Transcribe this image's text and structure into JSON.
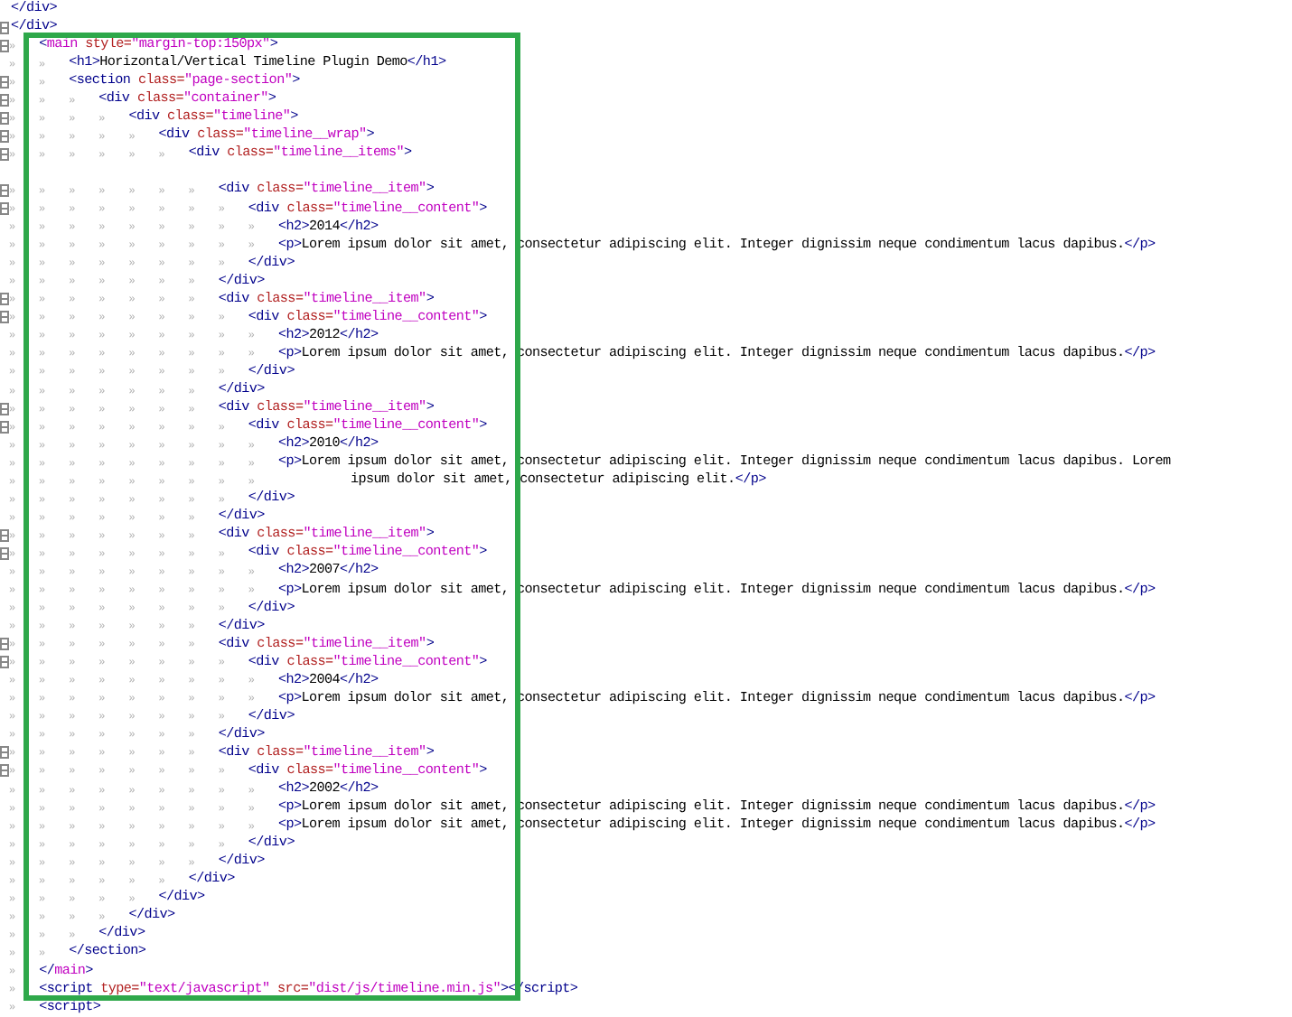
{
  "lines": [
    {
      "fold": false,
      "tokens": [
        {
          "kind": "tag",
          "text": "</div>"
        }
      ]
    },
    {
      "fold": true,
      "tokens": [
        {
          "kind": "tag",
          "text": "</div>"
        }
      ]
    },
    {
      "fold": true,
      "indent": "»",
      "tokens": [
        {
          "kind": "tag",
          "text": "<"
        },
        {
          "kind": "keyword",
          "text": "main"
        },
        {
          "kind": "attr",
          "text": " style="
        },
        {
          "kind": "value",
          "text": "\"margin-top:150px\""
        },
        {
          "kind": "tag",
          "text": ">"
        }
      ]
    },
    {
      "fold": false,
      "indent": "»»",
      "tokens": [
        {
          "kind": "tag",
          "text": "<h1>"
        },
        {
          "kind": "text",
          "text": "Horizontal/Vertical Timeline Plugin Demo"
        },
        {
          "kind": "tag",
          "text": "</h1>"
        }
      ]
    },
    {
      "fold": true,
      "indent": "»»",
      "tokens": [
        {
          "kind": "tag",
          "text": "<section "
        },
        {
          "kind": "attr",
          "text": "class="
        },
        {
          "kind": "value",
          "text": "\"page-section\""
        },
        {
          "kind": "tag",
          "text": ">"
        }
      ]
    },
    {
      "fold": true,
      "indent": "»»»",
      "tokens": [
        {
          "kind": "tag",
          "text": "<div "
        },
        {
          "kind": "attr",
          "text": "class="
        },
        {
          "kind": "value",
          "text": "\"container\""
        },
        {
          "kind": "tag",
          "text": ">"
        }
      ]
    },
    {
      "fold": true,
      "indent": "»»»»",
      "tokens": [
        {
          "kind": "tag",
          "text": "<div "
        },
        {
          "kind": "attr",
          "text": "class="
        },
        {
          "kind": "value",
          "text": "\"timeline\""
        },
        {
          "kind": "tag",
          "text": ">"
        }
      ]
    },
    {
      "fold": true,
      "indent": "»»»»»",
      "tokens": [
        {
          "kind": "tag",
          "text": "<div "
        },
        {
          "kind": "attr",
          "text": "class="
        },
        {
          "kind": "value",
          "text": "\"timeline__wrap\""
        },
        {
          "kind": "tag",
          "text": ">"
        }
      ]
    },
    {
      "fold": true,
      "indent": "»»»»»»",
      "tokens": [
        {
          "kind": "tag",
          "text": "<div "
        },
        {
          "kind": "attr",
          "text": "class="
        },
        {
          "kind": "value",
          "text": "\"timeline__items\""
        },
        {
          "kind": "tag",
          "text": ">"
        }
      ]
    },
    {
      "fold": false
    },
    {
      "fold": true,
      "indent": "»»»»»»»",
      "tokens": [
        {
          "kind": "tag",
          "text": "<div "
        },
        {
          "kind": "attr",
          "text": "class="
        },
        {
          "kind": "value",
          "text": "\"timeline__item\""
        },
        {
          "kind": "tag",
          "text": ">"
        }
      ]
    },
    {
      "fold": true,
      "indent": "»»»»»»»»",
      "tokens": [
        {
          "kind": "tag",
          "text": "<div "
        },
        {
          "kind": "attr",
          "text": "class="
        },
        {
          "kind": "value",
          "text": "\"timeline__content\""
        },
        {
          "kind": "tag",
          "text": ">"
        }
      ]
    },
    {
      "fold": false,
      "indent": "»»»»»»»»»",
      "tokens": [
        {
          "kind": "tag",
          "text": "<h2>"
        },
        {
          "kind": "text",
          "text": "2014"
        },
        {
          "kind": "tag",
          "text": "</h2>"
        }
      ]
    },
    {
      "fold": false,
      "indent": "»»»»»»»»»",
      "tokens": [
        {
          "kind": "tag",
          "text": "<p>"
        },
        {
          "kind": "text",
          "text": "Lorem ipsum dolor sit amet, consectetur adipiscing elit. Integer dignissim neque condimentum lacus dapibus."
        },
        {
          "kind": "tag",
          "text": "</p>"
        }
      ]
    },
    {
      "fold": false,
      "indent": "»»»»»»»»",
      "tokens": [
        {
          "kind": "tag",
          "text": "</div>"
        }
      ]
    },
    {
      "fold": false,
      "indent": "»»»»»»»",
      "tokens": [
        {
          "kind": "tag",
          "text": "</div>"
        }
      ]
    },
    {
      "fold": true,
      "indent": "»»»»»»»",
      "tokens": [
        {
          "kind": "tag",
          "text": "<div "
        },
        {
          "kind": "attr",
          "text": "class="
        },
        {
          "kind": "value",
          "text": "\"timeline__item\""
        },
        {
          "kind": "tag",
          "text": ">"
        }
      ]
    },
    {
      "fold": true,
      "indent": "»»»»»»»»",
      "tokens": [
        {
          "kind": "tag",
          "text": "<div "
        },
        {
          "kind": "attr",
          "text": "class="
        },
        {
          "kind": "value",
          "text": "\"timeline__content\""
        },
        {
          "kind": "tag",
          "text": ">"
        }
      ]
    },
    {
      "fold": false,
      "indent": "»»»»»»»»»",
      "tokens": [
        {
          "kind": "tag",
          "text": "<h2>"
        },
        {
          "kind": "text",
          "text": "2012"
        },
        {
          "kind": "tag",
          "text": "</h2>"
        }
      ]
    },
    {
      "fold": false,
      "indent": "»»»»»»»»»",
      "tokens": [
        {
          "kind": "tag",
          "text": "<p>"
        },
        {
          "kind": "text",
          "text": "Lorem ipsum dolor sit amet, consectetur adipiscing elit. Integer dignissim neque condimentum lacus dapibus."
        },
        {
          "kind": "tag",
          "text": "</p>"
        }
      ]
    },
    {
      "fold": false,
      "indent": "»»»»»»»»",
      "tokens": [
        {
          "kind": "tag",
          "text": "</div>"
        }
      ]
    },
    {
      "fold": false,
      "indent": "»»»»»»»",
      "tokens": [
        {
          "kind": "tag",
          "text": "</div>"
        }
      ]
    },
    {
      "fold": true,
      "indent": "»»»»»»»",
      "tokens": [
        {
          "kind": "tag",
          "text": "<div "
        },
        {
          "kind": "attr",
          "text": "class="
        },
        {
          "kind": "value",
          "text": "\"timeline__item\""
        },
        {
          "kind": "tag",
          "text": ">"
        }
      ]
    },
    {
      "fold": true,
      "indent": "»»»»»»»»",
      "tokens": [
        {
          "kind": "tag",
          "text": "<div "
        },
        {
          "kind": "attr",
          "text": "class="
        },
        {
          "kind": "value",
          "text": "\"timeline__content\""
        },
        {
          "kind": "tag",
          "text": ">"
        }
      ]
    },
    {
      "fold": false,
      "indent": "»»»»»»»»»",
      "tokens": [
        {
          "kind": "tag",
          "text": "<h2>"
        },
        {
          "kind": "text",
          "text": "2010"
        },
        {
          "kind": "tag",
          "text": "</h2>"
        }
      ]
    },
    {
      "fold": false,
      "indent": "»»»»»»»»»",
      "tokens": [
        {
          "kind": "tag",
          "text": "<p>"
        },
        {
          "kind": "text",
          "text": "Lorem ipsum dolor sit amet, consectetur adipiscing elit. Integer dignissim neque condimentum lacus dapibus. Lorem"
        }
      ]
    },
    {
      "fold": false,
      "indent": "»»»»»»»»»",
      "wrapped": true,
      "tokens": [
        {
          "kind": "text",
          "text": "ipsum dolor sit amet, consectetur adipiscing elit."
        },
        {
          "kind": "tag",
          "text": "</p>"
        }
      ]
    },
    {
      "fold": false,
      "indent": "»»»»»»»»",
      "tokens": [
        {
          "kind": "tag",
          "text": "</div>"
        }
      ]
    },
    {
      "fold": false,
      "indent": "»»»»»»»",
      "tokens": [
        {
          "kind": "tag",
          "text": "</div>"
        }
      ]
    },
    {
      "fold": true,
      "indent": "»»»»»»»",
      "tokens": [
        {
          "kind": "tag",
          "text": "<div "
        },
        {
          "kind": "attr",
          "text": "class="
        },
        {
          "kind": "value",
          "text": "\"timeline__item\""
        },
        {
          "kind": "tag",
          "text": ">"
        }
      ]
    },
    {
      "fold": true,
      "indent": "»»»»»»»»",
      "tokens": [
        {
          "kind": "tag",
          "text": "<div "
        },
        {
          "kind": "attr",
          "text": "class="
        },
        {
          "kind": "value",
          "text": "\"timeline__content\""
        },
        {
          "kind": "tag",
          "text": ">"
        }
      ]
    },
    {
      "fold": false,
      "indent": "»»»»»»»»»",
      "tokens": [
        {
          "kind": "tag",
          "text": "<h2>"
        },
        {
          "kind": "text",
          "text": "2007"
        },
        {
          "kind": "tag",
          "text": "</h2>"
        }
      ]
    },
    {
      "fold": false,
      "indent": "»»»»»»»»»",
      "tokens": [
        {
          "kind": "tag",
          "text": "<p>"
        },
        {
          "kind": "text",
          "text": "Lorem ipsum dolor sit amet, consectetur adipiscing elit. Integer dignissim neque condimentum lacus dapibus."
        },
        {
          "kind": "tag",
          "text": "</p>"
        }
      ]
    },
    {
      "fold": false,
      "indent": "»»»»»»»»",
      "tokens": [
        {
          "kind": "tag",
          "text": "</div>"
        }
      ]
    },
    {
      "fold": false,
      "indent": "»»»»»»»",
      "tokens": [
        {
          "kind": "tag",
          "text": "</div>"
        }
      ]
    },
    {
      "fold": true,
      "indent": "»»»»»»»",
      "tokens": [
        {
          "kind": "tag",
          "text": "<div "
        },
        {
          "kind": "attr",
          "text": "class="
        },
        {
          "kind": "value",
          "text": "\"timeline__item\""
        },
        {
          "kind": "tag",
          "text": ">"
        }
      ]
    },
    {
      "fold": true,
      "indent": "»»»»»»»»",
      "tokens": [
        {
          "kind": "tag",
          "text": "<div "
        },
        {
          "kind": "attr",
          "text": "class="
        },
        {
          "kind": "value",
          "text": "\"timeline__content\""
        },
        {
          "kind": "tag",
          "text": ">"
        }
      ]
    },
    {
      "fold": false,
      "indent": "»»»»»»»»»",
      "tokens": [
        {
          "kind": "tag",
          "text": "<h2>"
        },
        {
          "kind": "text",
          "text": "2004"
        },
        {
          "kind": "tag",
          "text": "</h2>"
        }
      ]
    },
    {
      "fold": false,
      "indent": "»»»»»»»»»",
      "tokens": [
        {
          "kind": "tag",
          "text": "<p>"
        },
        {
          "kind": "text",
          "text": "Lorem ipsum dolor sit amet, consectetur adipiscing elit. Integer dignissim neque condimentum lacus dapibus."
        },
        {
          "kind": "tag",
          "text": "</p>"
        }
      ]
    },
    {
      "fold": false,
      "indent": "»»»»»»»»",
      "tokens": [
        {
          "kind": "tag",
          "text": "</div>"
        }
      ]
    },
    {
      "fold": false,
      "indent": "»»»»»»»",
      "tokens": [
        {
          "kind": "tag",
          "text": "</div>"
        }
      ]
    },
    {
      "fold": true,
      "indent": "»»»»»»»",
      "tokens": [
        {
          "kind": "tag",
          "text": "<div "
        },
        {
          "kind": "attr",
          "text": "class="
        },
        {
          "kind": "value",
          "text": "\"timeline__item\""
        },
        {
          "kind": "tag",
          "text": ">"
        }
      ]
    },
    {
      "fold": true,
      "indent": "»»»»»»»»",
      "tokens": [
        {
          "kind": "tag",
          "text": "<div "
        },
        {
          "kind": "attr",
          "text": "class="
        },
        {
          "kind": "value",
          "text": "\"timeline__content\""
        },
        {
          "kind": "tag",
          "text": ">"
        }
      ]
    },
    {
      "fold": false,
      "indent": "»»»»»»»»»",
      "tokens": [
        {
          "kind": "tag",
          "text": "<h2>"
        },
        {
          "kind": "text",
          "text": "2002"
        },
        {
          "kind": "tag",
          "text": "</h2>"
        }
      ]
    },
    {
      "fold": false,
      "indent": "»»»»»»»»»",
      "tokens": [
        {
          "kind": "tag",
          "text": "<p>"
        },
        {
          "kind": "text",
          "text": "Lorem ipsum dolor sit amet, consectetur adipiscing elit. Integer dignissim neque condimentum lacus dapibus."
        },
        {
          "kind": "tag",
          "text": "</p>"
        }
      ]
    },
    {
      "fold": false,
      "indent": "»»»»»»»»»",
      "tokens": [
        {
          "kind": "tag",
          "text": "<p>"
        },
        {
          "kind": "text",
          "text": "Lorem ipsum dolor sit amet, consectetur adipiscing elit. Integer dignissim neque condimentum lacus dapibus."
        },
        {
          "kind": "tag",
          "text": "</p>"
        }
      ]
    },
    {
      "fold": false,
      "indent": "»»»»»»»»",
      "tokens": [
        {
          "kind": "tag",
          "text": "</div>"
        }
      ]
    },
    {
      "fold": false,
      "indent": "»»»»»»»",
      "tokens": [
        {
          "kind": "tag",
          "text": "</div>"
        }
      ]
    },
    {
      "fold": false,
      "indent": "»»»»»»",
      "tokens": [
        {
          "kind": "tag",
          "text": "</div>"
        }
      ]
    },
    {
      "fold": false,
      "indent": "»»»»»",
      "tokens": [
        {
          "kind": "tag",
          "text": "</div>"
        }
      ]
    },
    {
      "fold": false,
      "indent": "»»»»",
      "tokens": [
        {
          "kind": "tag",
          "text": "</div>"
        }
      ]
    },
    {
      "fold": false,
      "indent": "»»»",
      "tokens": [
        {
          "kind": "tag",
          "text": "</div>"
        }
      ]
    },
    {
      "fold": false,
      "indent": "»»",
      "tokens": [
        {
          "kind": "tag",
          "text": "</section>"
        }
      ]
    },
    {
      "fold": false,
      "indent": "»",
      "tokens": [
        {
          "kind": "tag",
          "text": "</"
        },
        {
          "kind": "keyword",
          "text": "main"
        },
        {
          "kind": "tag",
          "text": ">"
        }
      ]
    },
    {
      "fold": false,
      "indent": "»",
      "tokens": [
        {
          "kind": "tag",
          "text": "<script "
        },
        {
          "kind": "attr",
          "text": "type="
        },
        {
          "kind": "value",
          "text": "\"text/javascript\""
        },
        {
          "kind": "attr",
          "text": " src="
        },
        {
          "kind": "value",
          "text": "\"dist/js/timeline.min.js\""
        },
        {
          "kind": "tag",
          "text": "></script>"
        }
      ]
    },
    {
      "fold": false,
      "indent": "»",
      "tokens": [
        {
          "kind": "tag",
          "text": "<script>"
        }
      ]
    }
  ]
}
